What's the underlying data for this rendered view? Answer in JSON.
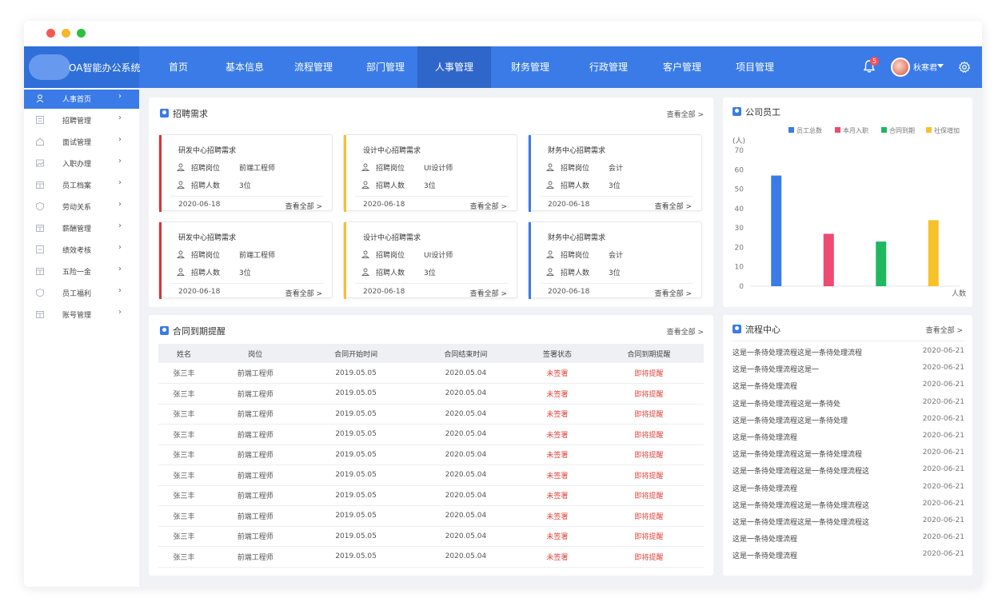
{
  "app": {
    "title": "OA智能办公系统"
  },
  "topnav": {
    "items": [
      {
        "label": "首页"
      },
      {
        "label": "基本信息"
      },
      {
        "label": "流程管理"
      },
      {
        "label": "部门管理"
      },
      {
        "label": "人事管理",
        "active": true
      },
      {
        "label": "财务管理"
      },
      {
        "label": "行政管理"
      },
      {
        "label": "客户管理"
      },
      {
        "label": "项目管理"
      }
    ],
    "notification_count": "5",
    "username": "秋寒君"
  },
  "sidebar": {
    "items": [
      {
        "label": "人事首页",
        "icon": "person-icon",
        "active": true
      },
      {
        "label": "招聘管理",
        "icon": "list-icon"
      },
      {
        "label": "面试管理",
        "icon": "home-icon"
      },
      {
        "label": "入职办理",
        "icon": "image-icon"
      },
      {
        "label": "员工档案",
        "icon": "folder-icon"
      },
      {
        "label": "劳动关系",
        "icon": "shield-icon"
      },
      {
        "label": "薪酬管理",
        "icon": "folder-icon"
      },
      {
        "label": "绩效考核",
        "icon": "chart-icon"
      },
      {
        "label": "五险一金",
        "icon": "folder-icon"
      },
      {
        "label": "员工福利",
        "icon": "shield-icon"
      },
      {
        "label": "账号管理",
        "icon": "folder-icon"
      }
    ]
  },
  "recruit": {
    "title": "招聘需求",
    "more": "查看全部 >",
    "cards": [
      {
        "title": "研发中心招聘需求",
        "k1": "招聘岗位",
        "v1": "前端工程师",
        "k2": "招聘人数",
        "v2": "3位",
        "date": "2020-06-18",
        "link": "查看全部 >",
        "color": "#d4343a"
      },
      {
        "title": "设计中心招聘需求",
        "k1": "招聘岗位",
        "v1": "UI设计师",
        "k2": "招聘人数",
        "v2": "3位",
        "date": "2020-06-18",
        "link": "查看全部 >",
        "color": "#f2c230"
      },
      {
        "title": "财务中心招聘需求",
        "k1": "招聘岗位",
        "v1": "会计",
        "k2": "招聘人数",
        "v2": "3位",
        "date": "2020-06-18",
        "link": "查看全部 >",
        "color": "#3a7be7"
      },
      {
        "title": "研发中心招聘需求",
        "k1": "招聘岗位",
        "v1": "前端工程师",
        "k2": "招聘人数",
        "v2": "3位",
        "date": "2020-06-18",
        "link": "查看全部 >",
        "color": "#d4343a"
      },
      {
        "title": "设计中心招聘需求",
        "k1": "招聘岗位",
        "v1": "UI设计师",
        "k2": "招聘人数",
        "v2": "3位",
        "date": "2020-06-18",
        "link": "查看全部 >",
        "color": "#f2c230"
      },
      {
        "title": "财务中心招聘需求",
        "k1": "招聘岗位",
        "v1": "会计",
        "k2": "招聘人数",
        "v2": "3位",
        "date": "2020-06-18",
        "link": "查看全部 >",
        "color": "#3a7be7"
      }
    ]
  },
  "employees": {
    "title": "公司员工",
    "chart_data": {
      "type": "bar",
      "ylabel": "(人)",
      "xlabel": "人数",
      "ylim": [
        0,
        70
      ],
      "yticks": [
        0,
        10,
        20,
        30,
        40,
        50,
        60,
        70
      ],
      "legend_position": "top-right",
      "series": [
        {
          "name": "员工总数",
          "value": 57,
          "color": "#3a7be7"
        },
        {
          "name": "本月入职",
          "value": 27,
          "color": "#ee4a72"
        },
        {
          "name": "合同到期",
          "value": 23,
          "color": "#1fb860"
        },
        {
          "name": "社保增加",
          "value": 34,
          "color": "#f7c12a"
        }
      ]
    }
  },
  "contracts": {
    "title": "合同到期提醒",
    "more": "查看全部 >",
    "columns": [
      "姓名",
      "岗位",
      "合同开始时间",
      "合同结束时间",
      "签署状态",
      "合同到期提醒"
    ],
    "rows": [
      [
        "张三丰",
        "前端工程师",
        "2019.05.05",
        "2020.05.04",
        "未签署",
        "即将提醒"
      ],
      [
        "张三丰",
        "前端工程师",
        "2019.05.05",
        "2020.05.04",
        "未签署",
        "即将提醒"
      ],
      [
        "张三丰",
        "前端工程师",
        "2019.05.05",
        "2020.05.04",
        "未签署",
        "即将提醒"
      ],
      [
        "张三丰",
        "前端工程师",
        "2019.05.05",
        "2020.05.04",
        "未签署",
        "即将提醒"
      ],
      [
        "张三丰",
        "前端工程师",
        "2019.05.05",
        "2020.05.04",
        "未签署",
        "即将提醒"
      ],
      [
        "张三丰",
        "前端工程师",
        "2019.05.05",
        "2020.05.04",
        "未签署",
        "即将提醒"
      ],
      [
        "张三丰",
        "前端工程师",
        "2019.05.05",
        "2020.05.04",
        "未签署",
        "即将提醒"
      ],
      [
        "张三丰",
        "前端工程师",
        "2019.05.05",
        "2020.05.04",
        "未签署",
        "即将提醒"
      ],
      [
        "张三丰",
        "前端工程师",
        "2019.05.05",
        "2020.05.04",
        "未签署",
        "即将提醒"
      ],
      [
        "张三丰",
        "前端工程师",
        "2019.05.05",
        "2020.05.04",
        "未签署",
        "即将提醒"
      ]
    ]
  },
  "flow": {
    "title": "流程中心",
    "more": "查看全部 >",
    "items": [
      {
        "text": "这是一条待处理流程这是一条待处理流程",
        "date": "2020-06-21"
      },
      {
        "text": "这是一条待处理流程这是一",
        "date": "2020-06-21"
      },
      {
        "text": "这是一条待处理流程",
        "date": "2020-06-21"
      },
      {
        "text": "这是一条待处理流程这是一条待处",
        "date": "2020-06-21"
      },
      {
        "text": "这是一条待处理流程这是一条待处理",
        "date": "2020-06-21"
      },
      {
        "text": "这是一条待处理流程",
        "date": "2020-06-21"
      },
      {
        "text": "这是一条待处理流程这是一条待处理流程",
        "date": "2020-06-21"
      },
      {
        "text": "这是一条待处理流程这是一条待处理流程这",
        "date": "2020-06-21"
      },
      {
        "text": "这是一条待处理流程",
        "date": "2020-06-21"
      },
      {
        "text": "这是一条待处理流程这是一条待处理流程这",
        "date": "2020-06-21"
      },
      {
        "text": "这是一条待处理流程这是一条待处理流程这",
        "date": "2020-06-21"
      },
      {
        "text": "这是一条待处理流程",
        "date": "2020-06-21"
      },
      {
        "text": "这是一条待处理流程",
        "date": "2020-06-21"
      }
    ]
  }
}
